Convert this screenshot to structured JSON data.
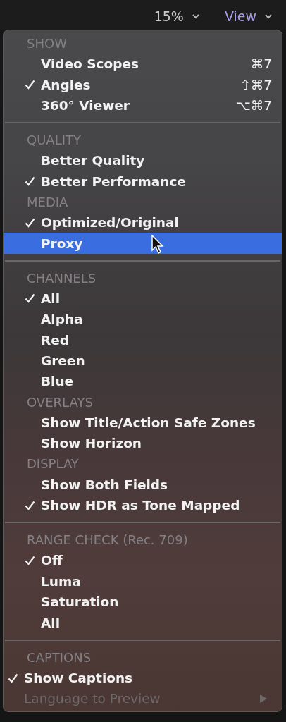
{
  "toolbar": {
    "zoom": "15%",
    "view": "View"
  },
  "menu": {
    "sections": [
      {
        "kind": "inset",
        "groups": [
          {
            "header": "SHOW",
            "items": [
              {
                "label": "Video Scopes",
                "checked": false,
                "shortcut": "⌘7",
                "selected": false,
                "disabled": false,
                "submenu": false
              },
              {
                "label": "Angles",
                "checked": true,
                "shortcut": "⇧⌘7",
                "selected": false,
                "disabled": false,
                "submenu": false
              },
              {
                "label": "360° Viewer",
                "checked": false,
                "shortcut": "⌥⌘7",
                "selected": false,
                "disabled": false,
                "submenu": false
              }
            ]
          }
        ]
      },
      {
        "kind": "inset",
        "groups": [
          {
            "header": "QUALITY",
            "items": [
              {
                "label": "Better Quality",
                "checked": false,
                "selected": false,
                "disabled": false,
                "submenu": false
              },
              {
                "label": "Better Performance",
                "checked": true,
                "selected": false,
                "disabled": false,
                "submenu": false
              }
            ]
          },
          {
            "header": "MEDIA",
            "items": [
              {
                "label": "Optimized/Original",
                "checked": true,
                "selected": false,
                "disabled": false,
                "submenu": false
              },
              {
                "label": "Proxy",
                "checked": false,
                "selected": true,
                "disabled": false,
                "submenu": false
              }
            ]
          }
        ]
      },
      {
        "kind": "inset",
        "groups": [
          {
            "header": "CHANNELS",
            "items": [
              {
                "label": "All",
                "checked": true,
                "selected": false,
                "disabled": false,
                "submenu": false
              },
              {
                "label": "Alpha",
                "checked": false,
                "selected": false,
                "disabled": false,
                "submenu": false
              },
              {
                "label": "Red",
                "checked": false,
                "selected": false,
                "disabled": false,
                "submenu": false
              },
              {
                "label": "Green",
                "checked": false,
                "selected": false,
                "disabled": false,
                "submenu": false
              },
              {
                "label": "Blue",
                "checked": false,
                "selected": false,
                "disabled": false,
                "submenu": false
              }
            ]
          },
          {
            "header": "OVERLAYS",
            "items": [
              {
                "label": "Show Title/Action Safe Zones",
                "checked": false,
                "selected": false,
                "disabled": false,
                "submenu": false
              },
              {
                "label": "Show Horizon",
                "checked": false,
                "selected": false,
                "disabled": false,
                "submenu": false
              }
            ]
          },
          {
            "header": "DISPLAY",
            "items": [
              {
                "label": "Show Both Fields",
                "checked": false,
                "selected": false,
                "disabled": false,
                "submenu": false
              },
              {
                "label": "Show HDR as Tone Mapped",
                "checked": true,
                "selected": false,
                "disabled": false,
                "submenu": false
              }
            ]
          }
        ]
      },
      {
        "kind": "inset",
        "groups": [
          {
            "header": "RANGE CHECK (Rec. 709)",
            "items": [
              {
                "label": "Off",
                "checked": true,
                "selected": false,
                "disabled": false,
                "submenu": false
              },
              {
                "label": "Luma",
                "checked": false,
                "selected": false,
                "disabled": false,
                "submenu": false
              },
              {
                "label": "Saturation",
                "checked": false,
                "selected": false,
                "disabled": false,
                "submenu": false
              },
              {
                "label": "All",
                "checked": false,
                "selected": false,
                "disabled": false,
                "submenu": false
              }
            ]
          }
        ]
      },
      {
        "kind": "flush",
        "groups": [
          {
            "header": "CAPTIONS",
            "items": [
              {
                "label": "Show Captions",
                "checked": true,
                "selected": false,
                "disabled": false,
                "submenu": false
              },
              {
                "label": "Language to Preview",
                "checked": false,
                "selected": false,
                "disabled": true,
                "submenu": true
              }
            ]
          }
        ]
      }
    ]
  }
}
